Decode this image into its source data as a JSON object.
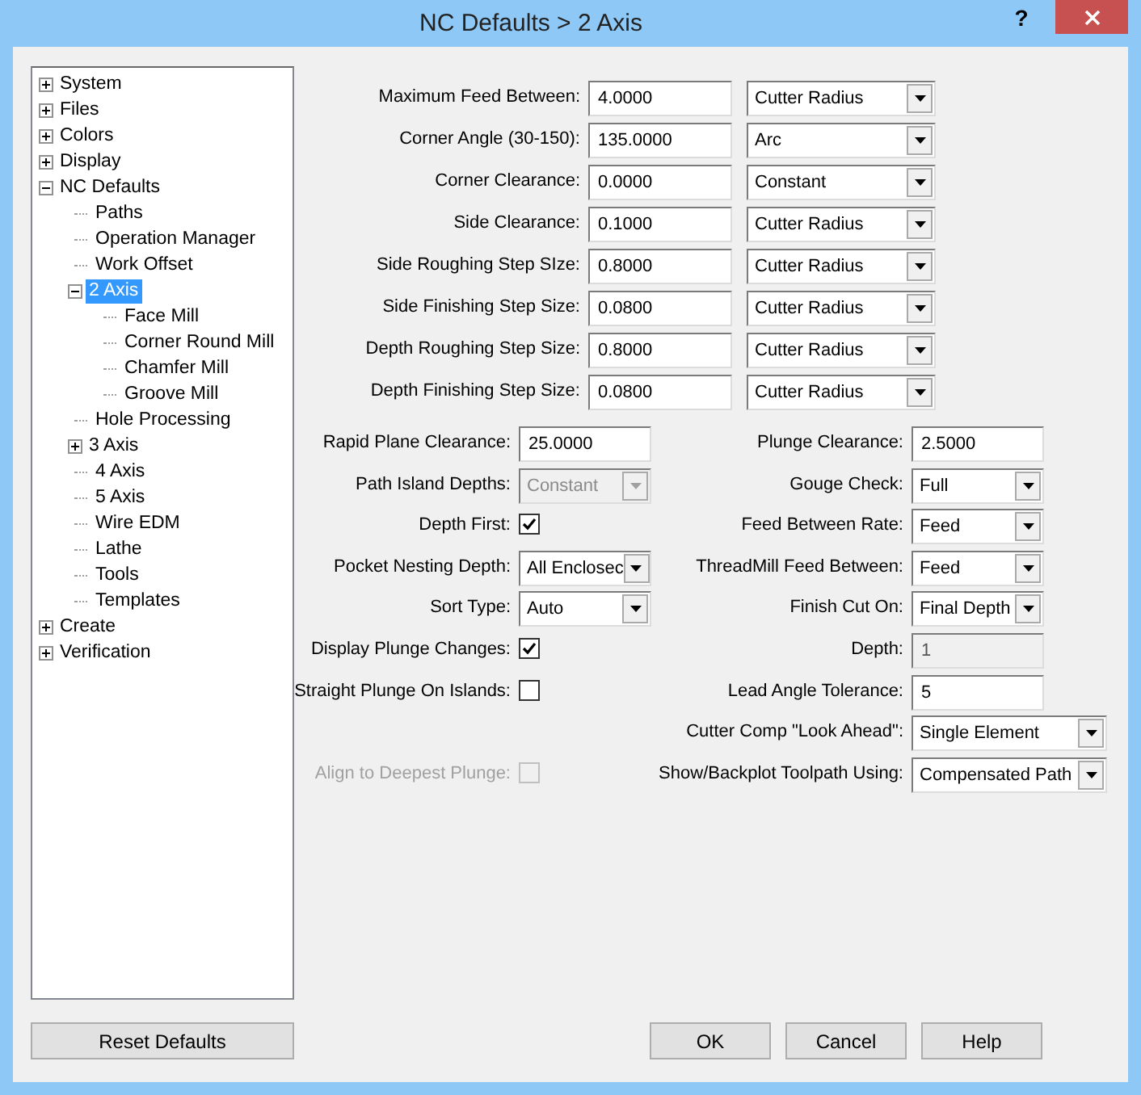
{
  "window": {
    "title": "NC Defaults > 2 Axis",
    "help": "?"
  },
  "tree": [
    {
      "label": "System",
      "expanded": false,
      "selected": false
    },
    {
      "label": "Files",
      "expanded": false,
      "selected": false
    },
    {
      "label": "Colors",
      "expanded": false,
      "selected": false
    },
    {
      "label": "Display",
      "expanded": false,
      "selected": false
    },
    {
      "label": "NC Defaults",
      "expanded": true,
      "selected": false,
      "children": [
        {
          "label": "Paths",
          "selected": false
        },
        {
          "label": "Operation Manager",
          "selected": false
        },
        {
          "label": "Work Offset",
          "selected": false
        },
        {
          "label": "2 Axis",
          "expanded": true,
          "selected": true,
          "children": [
            {
              "label": "Face Mill",
              "selected": false
            },
            {
              "label": "Corner Round Mill",
              "selected": false
            },
            {
              "label": "Chamfer Mill",
              "selected": false
            },
            {
              "label": "Groove Mill",
              "selected": false
            }
          ]
        },
        {
          "label": "Hole Processing",
          "selected": false
        },
        {
          "label": "3 Axis",
          "expanded": false,
          "selected": false
        },
        {
          "label": "4 Axis",
          "selected": false
        },
        {
          "label": "5 Axis",
          "selected": false
        },
        {
          "label": "Wire EDM",
          "selected": false
        },
        {
          "label": "Lathe",
          "selected": false
        },
        {
          "label": "Tools",
          "selected": false
        },
        {
          "label": "Templates",
          "selected": false
        }
      ]
    },
    {
      "label": "Create",
      "expanded": false,
      "selected": false
    },
    {
      "label": "Verification",
      "expanded": false,
      "selected": false
    }
  ],
  "top_rows": [
    {
      "label": "Maximum Feed Between:",
      "value": "4.0000",
      "option": "Cutter Radius"
    },
    {
      "label": "Corner Angle (30-150):",
      "value": "135.0000",
      "option": "Arc"
    },
    {
      "label": "Corner Clearance:",
      "value": "0.0000",
      "option": "Constant"
    },
    {
      "label": "Side Clearance:",
      "value": "0.1000",
      "option": "Cutter Radius"
    },
    {
      "label": "Side Roughing Step SIze:",
      "value": "0.8000",
      "option": "Cutter Radius"
    },
    {
      "label": "Side Finishing Step Size:",
      "value": "0.0800",
      "option": "Cutter Radius"
    },
    {
      "label": "Depth Roughing Step Size:",
      "value": "0.8000",
      "option": "Cutter Radius"
    },
    {
      "label": "Depth Finishing Step Size:",
      "value": "0.0800",
      "option": "Cutter Radius"
    }
  ],
  "left_fields": [
    {
      "kind": "input",
      "label": "Rapid Plane Clearance:",
      "value": "25.0000",
      "disabled": false
    },
    {
      "kind": "select",
      "label": "Path Island Depths:",
      "value": "Constant",
      "disabled": true
    },
    {
      "kind": "checkbox",
      "label": "Depth First:",
      "checked": true,
      "disabled": false
    },
    {
      "kind": "select",
      "label": "Pocket Nesting Depth:",
      "value": "All Enclosec",
      "disabled": false
    },
    {
      "kind": "select",
      "label": "Sort Type:",
      "value": "Auto",
      "disabled": false
    },
    {
      "kind": "checkbox",
      "label": "Display Plunge Changes:",
      "checked": true,
      "disabled": false
    },
    {
      "kind": "checkbox",
      "label": "Straight Plunge On Islands:",
      "checked": false,
      "disabled": false
    },
    {
      "kind": "checkbox",
      "label": "Align to Deepest Plunge:",
      "checked": false,
      "disabled": true
    }
  ],
  "right_fields": [
    {
      "kind": "input",
      "label": "Plunge Clearance:",
      "value": "2.5000",
      "disabled": false
    },
    {
      "kind": "select",
      "label": "Gouge Check:",
      "value": "Full",
      "disabled": false
    },
    {
      "kind": "select",
      "label": "Feed Between Rate:",
      "value": "Feed",
      "disabled": false
    },
    {
      "kind": "select",
      "label": "ThreadMill Feed Between:",
      "value": "Feed",
      "disabled": false
    },
    {
      "kind": "select",
      "label": "Finish Cut On:",
      "value": "Final Depth",
      "disabled": false
    },
    {
      "kind": "input",
      "label": "Depth:",
      "value": "1",
      "disabled": true
    },
    {
      "kind": "input",
      "label": "Lead Angle Tolerance:",
      "value": "5",
      "disabled": false
    },
    {
      "kind": "select",
      "label": "Cutter Comp \"Look Ahead\":",
      "value": "Single Element",
      "disabled": false
    },
    {
      "kind": "select",
      "label": "Show/Backplot Toolpath Using:",
      "value": "Compensated Path",
      "disabled": false
    }
  ],
  "buttons": {
    "left": "Reset Defaults",
    "right": [
      "OK",
      "Cancel",
      "Help"
    ]
  }
}
